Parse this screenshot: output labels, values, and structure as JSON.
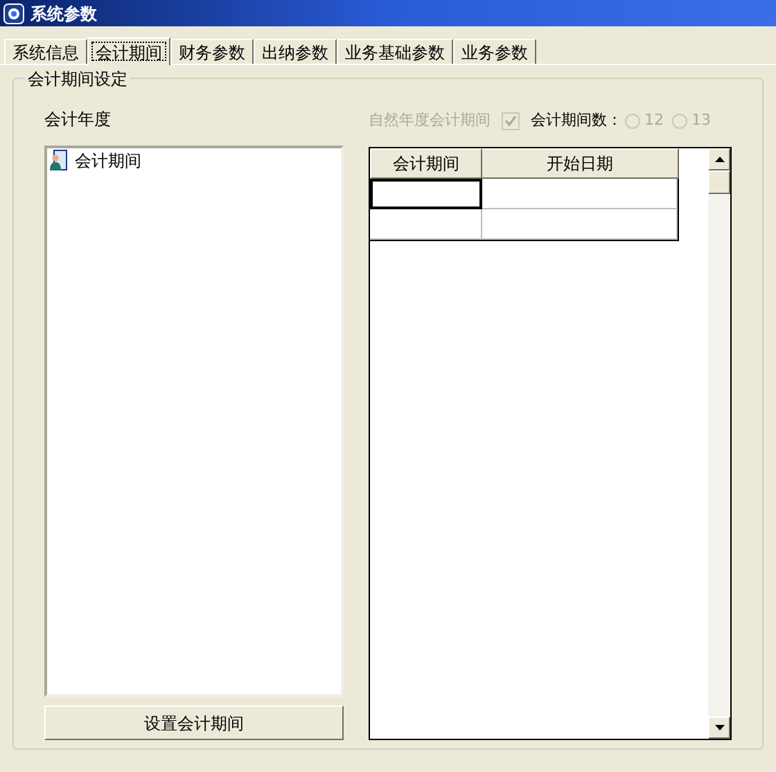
{
  "window": {
    "title": "系统参数"
  },
  "tabs": [
    {
      "label": "系统信息",
      "selected": false
    },
    {
      "label": "会计期间",
      "selected": true
    },
    {
      "label": "财务参数",
      "selected": false
    },
    {
      "label": "出纳参数",
      "selected": false
    },
    {
      "label": "业务基础参数",
      "selected": false
    },
    {
      "label": "业务参数",
      "selected": false
    }
  ],
  "group": {
    "title": "会计期间设定"
  },
  "fiscal_year": {
    "label": "会计年度",
    "tree": [
      {
        "label": "会计期间"
      }
    ],
    "button": "设置会计期间"
  },
  "natural_year": {
    "label": "自然年度会计期间",
    "checked": true,
    "disabled": true
  },
  "period_count": {
    "label": "会计期间数：",
    "disabled": true,
    "options": [
      {
        "label": "12",
        "selected": false
      },
      {
        "label": "13",
        "selected": false
      }
    ]
  },
  "table": {
    "columns": [
      "会计期间",
      "开始日期"
    ],
    "rows": [
      {
        "focused": true
      },
      {
        "focused": false
      }
    ]
  }
}
